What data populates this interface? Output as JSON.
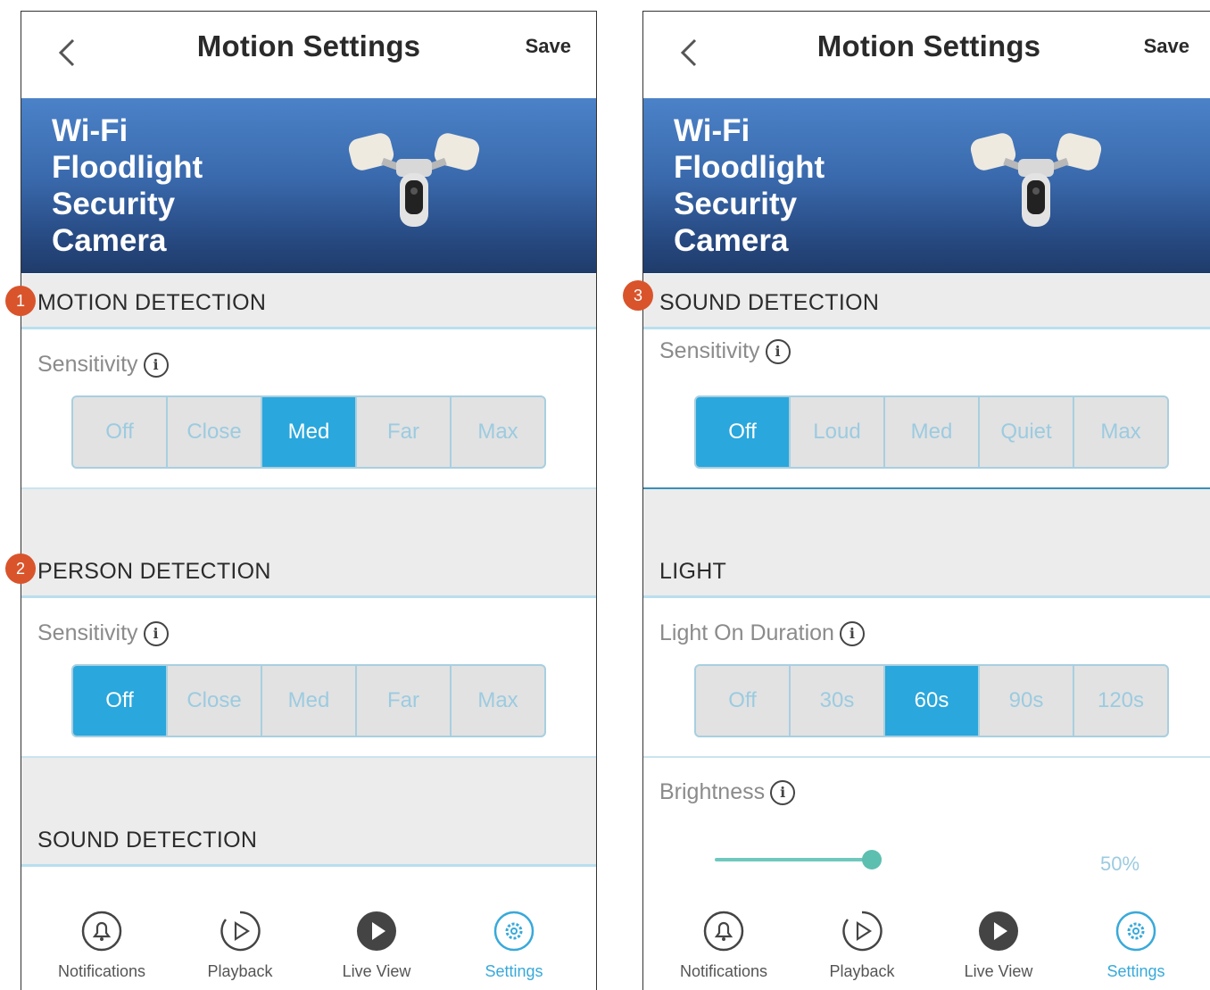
{
  "left": {
    "title": "Motion Settings",
    "save_label": "Save",
    "banner_lines": [
      "Wi-Fi",
      "Floodlight",
      "Security",
      "Camera"
    ],
    "badge1": "1",
    "badge2": "2",
    "motion": {
      "heading": "MOTION DETECTION",
      "sensitivity_label": "Sensitivity",
      "options": [
        "Off",
        "Close",
        "Med",
        "Far",
        "Max"
      ],
      "selected": "Med"
    },
    "person": {
      "heading": "PERSON DETECTION",
      "sensitivity_label": "Sensitivity",
      "options": [
        "Off",
        "Close",
        "Med",
        "Far",
        "Max"
      ],
      "selected": "Off"
    },
    "sound_heading": "SOUND DETECTION"
  },
  "right": {
    "title": "Motion Settings",
    "save_label": "Save",
    "banner_lines": [
      "Wi-Fi",
      "Floodlight",
      "Security",
      "Camera"
    ],
    "badge3": "3",
    "sound": {
      "heading": "SOUND DETECTION",
      "sensitivity_label": "Sensitivity",
      "options": [
        "Off",
        "Loud",
        "Med",
        "Quiet",
        "Max"
      ],
      "selected": "Off"
    },
    "light": {
      "heading": "LIGHT",
      "duration_label": "Light On Duration",
      "options": [
        "Off",
        "30s",
        "60s",
        "90s",
        "120s"
      ],
      "selected": "60s",
      "brightness_label": "Brightness",
      "brightness_value": "50%",
      "brightness_fraction": 0.5
    }
  },
  "info_glyph": "i",
  "tabs": [
    {
      "label": "Notifications",
      "icon": "bell-icon"
    },
    {
      "label": "Playback",
      "icon": "playback-icon"
    },
    {
      "label": "Live View",
      "icon": "live-view-icon"
    },
    {
      "label": "Settings",
      "icon": "gear-icon"
    }
  ],
  "colors": {
    "accent": "#2aa7dc",
    "banner": "#3a6aad",
    "badge": "#d9542b",
    "slider": "#6fc8be"
  }
}
